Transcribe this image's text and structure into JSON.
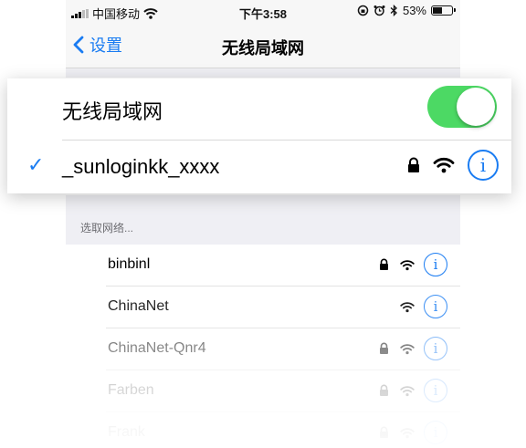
{
  "status_bar": {
    "carrier": "中国移动",
    "time": "下午3:58",
    "battery": "53%",
    "battery_level": 0.53,
    "signal_bars": 3,
    "icons": [
      "signal-icon",
      "wifi-icon",
      "rotation-lock-icon",
      "alarm-icon",
      "bluetooth-icon",
      "battery-icon"
    ]
  },
  "nav": {
    "back_label": "设置",
    "title": "无线局域网"
  },
  "wifi_toggle": {
    "label": "无线局域网",
    "on": true,
    "color": "#4cd964"
  },
  "connected": {
    "ssid": "_sunloginkk_xxxx",
    "locked": true
  },
  "choose_network_label": "选取网络...",
  "networks": [
    {
      "name": "binbinl",
      "locked": true,
      "opacity": 1.0
    },
    {
      "name": "ChinaNet",
      "locked": false,
      "opacity": 0.85
    },
    {
      "name": "ChinaNet-Qnr4",
      "locked": true,
      "opacity": 0.55
    },
    {
      "name": "Farben",
      "locked": true,
      "opacity": 0.3
    },
    {
      "name": "Frank",
      "locked": true,
      "opacity": 0.15
    }
  ],
  "accent_color": "#1a7cf2"
}
